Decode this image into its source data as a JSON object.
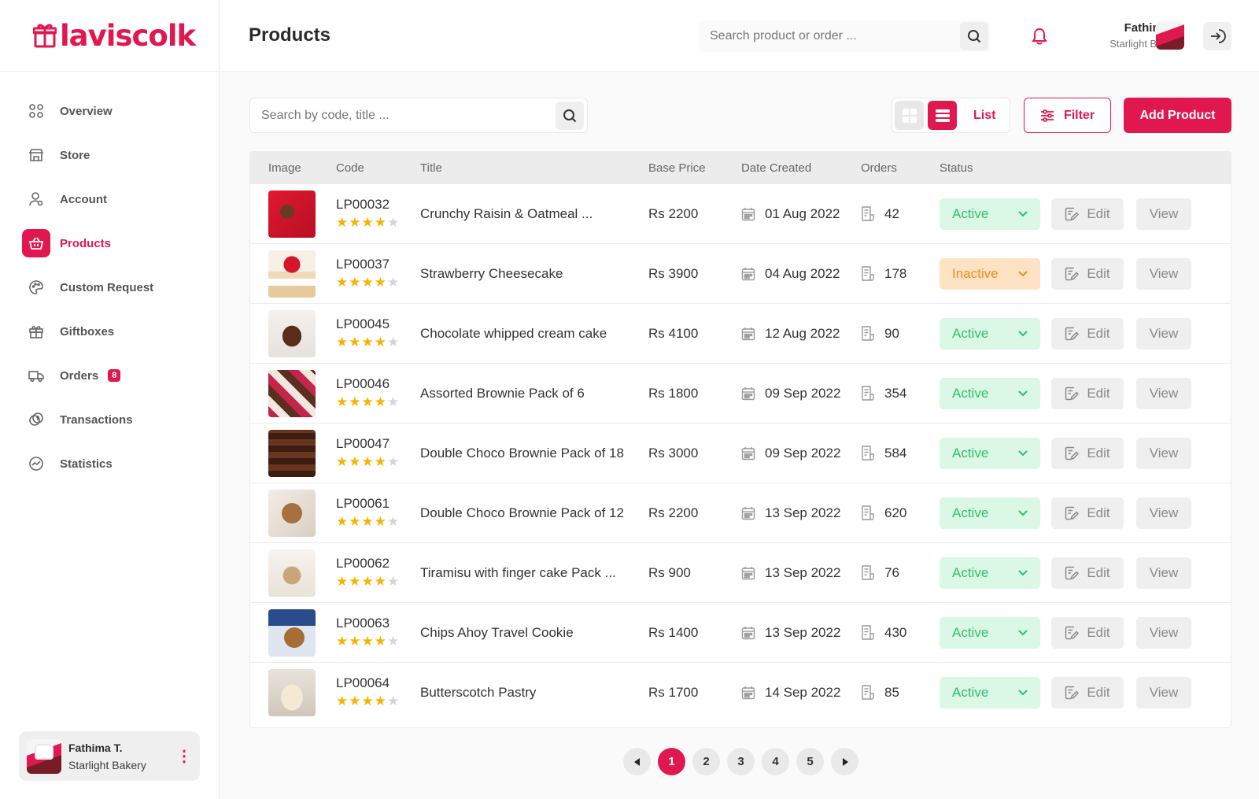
{
  "brand": {
    "logo_text": "laviscolk"
  },
  "sidebar": {
    "items": [
      {
        "label": "Overview",
        "icon": "grid-icon"
      },
      {
        "label": "Store",
        "icon": "store-icon"
      },
      {
        "label": "Account",
        "icon": "user-icon"
      },
      {
        "label": "Products",
        "icon": "basket-icon",
        "active": true
      },
      {
        "label": "Custom Request",
        "icon": "palette-icon"
      },
      {
        "label": "Giftboxes",
        "icon": "gift-icon"
      },
      {
        "label": "Orders",
        "icon": "truck-icon",
        "badge": "8"
      },
      {
        "label": "Transactions",
        "icon": "coins-icon"
      },
      {
        "label": "Statistics",
        "icon": "chart-icon"
      }
    ],
    "profile": {
      "name": "Fathima T.",
      "store": "Starlight Bakery"
    }
  },
  "header": {
    "title": "Products",
    "search_placeholder": "Search product or order ...",
    "user_name": "Fathima T.",
    "user_store": "Starlight Bakery"
  },
  "toolbar": {
    "search_placeholder": "Search by code, title ...",
    "view_label": "List",
    "filter_label": "Filter",
    "add_label": "Add Product"
  },
  "table": {
    "columns": [
      "Image",
      "Code",
      "Title",
      "Base Price",
      "Date Created",
      "Orders",
      "Status"
    ],
    "edit_label": "Edit",
    "view_label": "View",
    "rows": [
      {
        "code": "LP00032",
        "title": "Crunchy Raisin & Oatmeal ...",
        "price": "Rs 2200",
        "date": "01 Aug 2022",
        "orders": "42",
        "status": "Active",
        "rating": 4
      },
      {
        "code": "LP00037",
        "title": "Strawberry Cheesecake",
        "price": "Rs 3900",
        "date": "04 Aug 2022",
        "orders": "178",
        "status": "Inactive",
        "rating": 4
      },
      {
        "code": "LP00045",
        "title": "Chocolate whipped cream cake",
        "price": "Rs 4100",
        "date": "12 Aug 2022",
        "orders": "90",
        "status": "Active",
        "rating": 4
      },
      {
        "code": "LP00046",
        "title": "Assorted Brownie Pack of 6",
        "price": "Rs 1800",
        "date": "09 Sep 2022",
        "orders": "354",
        "status": "Active",
        "rating": 4
      },
      {
        "code": "LP00047",
        "title": "Double Choco Brownie Pack of 18",
        "price": "Rs 3000",
        "date": "09 Sep 2022",
        "orders": "584",
        "status": "Active",
        "rating": 4
      },
      {
        "code": "LP00061",
        "title": "Double Choco Brownie Pack of 12",
        "price": "Rs 2200",
        "date": "13 Sep 2022",
        "orders": "620",
        "status": "Active",
        "rating": 4
      },
      {
        "code": "LP00062",
        "title": "Tiramisu with finger cake Pack ...",
        "price": "Rs 900",
        "date": "13 Sep 2022",
        "orders": "76",
        "status": "Active",
        "rating": 4
      },
      {
        "code": "LP00063",
        "title": "Chips Ahoy Travel Cookie",
        "price": "Rs 1400",
        "date": "13 Sep 2022",
        "orders": "430",
        "status": "Active",
        "rating": 4
      },
      {
        "code": "LP00064",
        "title": "Butterscotch Pastry",
        "price": "Rs 1700",
        "date": "14 Sep 2022",
        "orders": "85",
        "status": "Active",
        "rating": 4
      }
    ]
  },
  "pagination": {
    "pages": [
      "1",
      "2",
      "3",
      "4",
      "5"
    ],
    "current": "1"
  },
  "colors": {
    "brand": "#e0184f",
    "active_bg": "#dbf7e6",
    "active_text": "#2fbf6c",
    "inactive_bg": "#fde3c3",
    "inactive_text": "#f08a1f",
    "star": "#f5b400"
  }
}
